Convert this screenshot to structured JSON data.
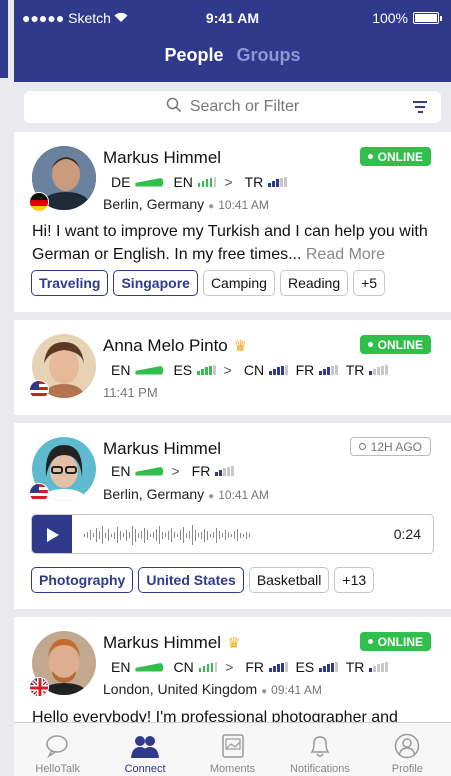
{
  "status_bar": {
    "carrier": "●●●●● Sketch",
    "time": "9:41 AM",
    "battery": "100%"
  },
  "segmented": {
    "people": "People",
    "groups": "Groups"
  },
  "search": {
    "placeholder": "Search or Filter"
  },
  "cards": [
    {
      "name": "Markus Himmel",
      "badge": "ONLINE",
      "langs": [
        "DE",
        "EN",
        "TR"
      ],
      "location": "Berlin, Germany",
      "time": "10:41 AM",
      "bio": "Hi! I want to improve my Turkish and I can help you with German or English. In my free times...",
      "read_more": "Read More",
      "tags": [
        "Traveling",
        "Singapore",
        "Camping",
        "Reading",
        "+5"
      ]
    },
    {
      "name": "Anna Melo Pinto",
      "badge": "ONLINE",
      "langs": [
        "EN",
        "ES",
        "CN",
        "FR",
        "TR"
      ],
      "time": "11:41 PM"
    },
    {
      "name": "Markus Himmel",
      "badge": "12H AGO",
      "langs": [
        "EN",
        "FR"
      ],
      "location": "Berlin, Germany",
      "time": "10:41 AM",
      "duration": "0:24",
      "tags": [
        "Photography",
        "United States",
        "Basketball",
        "+13"
      ]
    },
    {
      "name": "Markus Himmel",
      "badge": "ONLINE",
      "langs": [
        "EN",
        "CN",
        "FR",
        "ES",
        "TR"
      ],
      "location": "London, United Kingdom",
      "time": "09:41 AM",
      "bio": "Hello everybody! I'm professional photographer and"
    }
  ],
  "tabs": [
    "HelloTalk",
    "Connect",
    "Moments",
    "Notifications",
    "Profile"
  ],
  "colors": {
    "brand": "#2f3a8c",
    "online": "#2fbf4a"
  }
}
